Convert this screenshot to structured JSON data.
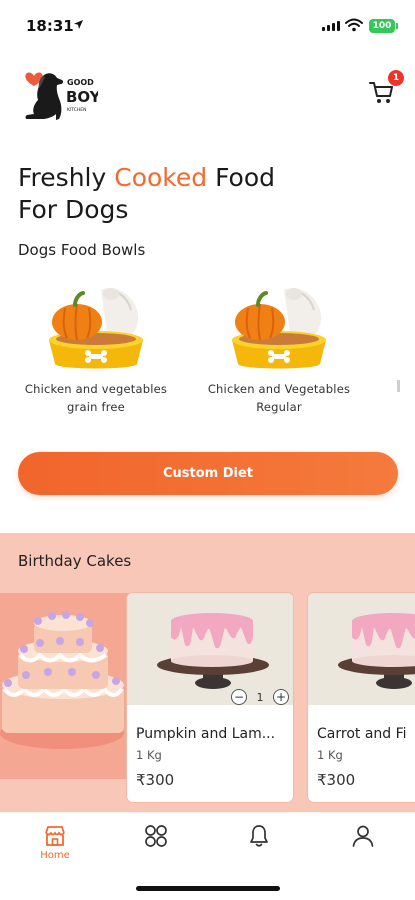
{
  "status": {
    "time": "18:31",
    "battery": "100"
  },
  "header": {
    "logo_text": [
      "GOOD",
      "BOY",
      "KITCHEN"
    ],
    "cart_badge": "1"
  },
  "headline": {
    "part1": "Freshly ",
    "accent": "Cooked",
    "part2": " Food For Dogs"
  },
  "bowls": {
    "title": "Dogs Food Bowls",
    "items": [
      {
        "name": "Chicken and vegetables grain free"
      },
      {
        "name": "Chicken and Vegetables Regular"
      }
    ]
  },
  "custom_diet": {
    "label": "Custom Diet"
  },
  "cakes": {
    "title": "Birthday Cakes",
    "products": [
      {
        "name": "Pumpkin and Lam...",
        "weight": "1 Kg",
        "price": "₹300",
        "qty": "1"
      },
      {
        "name": "Carrot and Fi",
        "weight": "1 Kg",
        "price": "₹300"
      }
    ]
  },
  "nav": {
    "items": [
      {
        "label": "Home",
        "icon": "store-icon",
        "active": true
      },
      {
        "label": "",
        "icon": "grid-icon"
      },
      {
        "label": "",
        "icon": "bell-icon"
      },
      {
        "label": "",
        "icon": "user-icon"
      }
    ]
  },
  "colors": {
    "accent": "#f26a2e",
    "cakes_bg": "#f9c7b7",
    "badge": "#f0332a"
  }
}
